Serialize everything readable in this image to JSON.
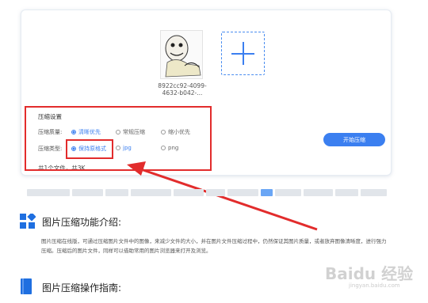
{
  "file": {
    "name": "8922cc92-4099-4632-b042-..."
  },
  "settings": {
    "title": "压缩设置",
    "quality": {
      "label": "压缩质量:",
      "options": [
        "清晰优先",
        "常规压缩",
        "缩小优先"
      ],
      "selected": "清晰优先"
    },
    "type": {
      "label": "压缩类型:",
      "options": [
        "保持原格式",
        "jpg",
        "png"
      ],
      "selected": "保持原格式"
    }
  },
  "start_button": "开始压缩",
  "summary": "共1个文件，共3K",
  "sections": {
    "intro_title": "图片压缩功能介绍:",
    "intro_text": "图片压缩在线版，可通过压缩图片文件中的图像，来减少文件的大小，并在图片文件压缩过程中，仍然保证其图片质量，或者放弃图像清晰度，进行强力压缩。压缩后的图片文件，同样可以借助常用的图片浏览器来打开及浏览。",
    "guide_title": "图片压缩操作指南:"
  },
  "watermark": {
    "text": "Baidu 经验",
    "sub": "jingyan.baidu.com"
  },
  "colors": {
    "accent": "#3b7ff0",
    "highlight": "#e22c2c"
  }
}
